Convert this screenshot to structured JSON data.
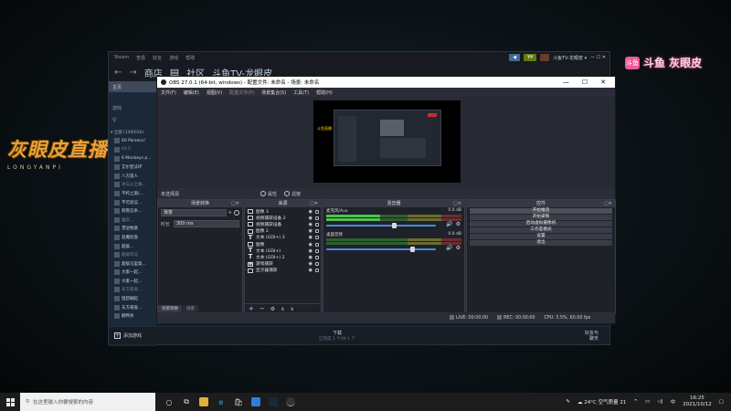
{
  "overlay": {
    "left_brand": "灰眼皮直播",
    "left_brand_sub": "LONGYANPI",
    "right_brand_logo": "斗鱼",
    "right_brand": "斗鱼 灰眼皮"
  },
  "steam": {
    "menubar": [
      "Steam",
      "查看",
      "好友",
      "游戏",
      "帮助"
    ],
    "notification_label": "◀",
    "wallet_label": "¥¥",
    "user_label": "斗鱼TV-龙眼皮 ▾",
    "nav": [
      "商店",
      "社区",
      "斗鱼TV-龙眼皮"
    ],
    "home_label": "主页",
    "games_label": "游戏",
    "category_all": "▾ 全部 (148/656)",
    "games": [
      "60 Parsecs!",
      "64.0",
      "6 Monkeys p...",
      "艾尔登法环",
      "八方旅人",
      "冰与火之舞...",
      "不朽之旅(...",
      "不可思议...",
      "刺客信条...",
      "幽灵...",
      "漂泊牧歌",
      "恶魔轮盘",
      "超级...",
      "超级鸡马",
      "超级马里奥...",
      "大家一起...",
      "大家一起...",
      "东方夜雀...",
      "怪猎崛起",
      "东方夜雀...",
      "鹅鸭杀"
    ],
    "add_game_label": "添加游戏",
    "download_label": "下载",
    "download_sub": "已完成 1 个/共 1 个",
    "friends_label": "好友与\n聊天"
  },
  "obs": {
    "title": "OBS 27.0.1 (64-bit, windows) - 配置文件: 未命名 - 场景: 未命名",
    "window_controls": [
      "—",
      "☐",
      "✕"
    ],
    "menu": [
      "文件(F)",
      "编辑(E)",
      "视图(V)",
      "配置文件(P)",
      "场景集合(S)",
      "工具(T)",
      "帮助(H)"
    ],
    "scene_bar_label": "未选择源",
    "properties_label": "属性",
    "filters_label": "滤镜",
    "preview_tag": "斗鱼直播",
    "dock_filters": {
      "title": "场景转换",
      "transition": "渐变",
      "duration_label": "时长",
      "duration_value": "300 ms",
      "tabs": [
        "场景转换",
        "场景"
      ]
    },
    "dock_sources": {
      "title": "来源",
      "items": [
        {
          "icon": "image",
          "name": "图像 3"
        },
        {
          "icon": "video",
          "name": "视频捕获设备 2"
        },
        {
          "icon": "video",
          "name": "视频捕获设备"
        },
        {
          "icon": "image",
          "name": "图像 2"
        },
        {
          "icon": "text",
          "name": "文本 (GDI+) 3"
        },
        {
          "icon": "image",
          "name": "图像"
        },
        {
          "icon": "text",
          "name": "文本 (GDI+)"
        },
        {
          "icon": "text",
          "name": "文本 (GDI+) 2"
        },
        {
          "icon": "game",
          "name": "游戏捕获"
        },
        {
          "icon": "display",
          "name": "显示器捕获"
        }
      ]
    },
    "dock_mixer": {
      "title": "混音器",
      "channels": [
        {
          "name": "麦克风/Aux",
          "db": "0.0 dB",
          "level": 0.62
        },
        {
          "name": "桌面音频",
          "db": "0.0 dB",
          "level": 0.78
        }
      ]
    },
    "dock_controls": {
      "title": "控件",
      "buttons": [
        "开始推流",
        "开始录制",
        "启动虚拟摄像机",
        "工作室模式",
        "设置",
        "退出"
      ]
    },
    "status": {
      "live_label": "LIVE:",
      "live_time": "00:00:00",
      "rec_label": "REC:",
      "rec_time": "00:00:00",
      "cpu": "CPU: 3.5%, 60.00 fps"
    }
  },
  "taskbar": {
    "search_placeholder": "在这里输入你要搜索的内容",
    "weather": "24°C 空气质量 21",
    "time": "16:25",
    "date": "2021/10/12",
    "ime": "中"
  }
}
